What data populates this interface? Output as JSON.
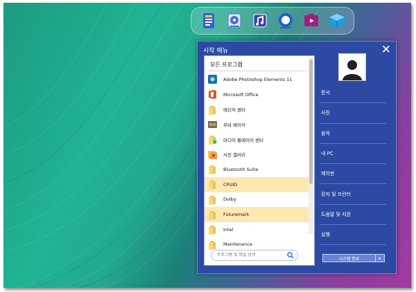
{
  "menu": {
    "title": "시작 메뉴",
    "close_glyph": "✕",
    "panel_header": "모든 프로그램",
    "programs": [
      {
        "label": "Adobe Photoshop Elements 11",
        "icon": "photoshop-elements-icon",
        "highlight": false
      },
      {
        "label": "Microsoft Office",
        "icon": "office-icon",
        "highlight": false
      },
      {
        "label": "메신저 센터",
        "icon": "folder-icon",
        "highlight": false
      },
      {
        "label": "무비 메이커",
        "icon": "movie-maker-icon",
        "highlight": false
      },
      {
        "label": "미디어 플레이어 센터",
        "icon": "folder-icon",
        "highlight": false
      },
      {
        "label": "사진 갤러리",
        "icon": "photo-gallery-icon",
        "highlight": false
      },
      {
        "label": "Bluetooth Suite",
        "icon": "folder-icon",
        "highlight": false
      },
      {
        "label": "CPUID",
        "icon": "folder-icon",
        "highlight": true
      },
      {
        "label": "Dolby",
        "icon": "folder-icon",
        "highlight": false
      },
      {
        "label": "Futuremark",
        "icon": "folder-icon",
        "highlight": true
      },
      {
        "label": "Intel",
        "icon": "folder-icon",
        "highlight": false
      },
      {
        "label": "Maintenance",
        "icon": "folder-icon",
        "highlight": false
      }
    ],
    "search_placeholder": "프로그램 및 파일 검색",
    "right_items": [
      "문서",
      "사진",
      "음악",
      "내 PC",
      "제어판",
      "장치 및 프린터",
      "도움말 및 지원",
      "실행"
    ],
    "shutdown_label": "시스템 종료",
    "shutdown_arrow": "▸"
  },
  "dock": {
    "icons": [
      "notebook-icon",
      "disc-drive-icon",
      "music-note-icon",
      "circle-app-icon",
      "media-player-icon",
      "cube-app-icon"
    ]
  },
  "colors": {
    "menu_bg": "#2c4aa3",
    "highlight": "#fce8b0"
  }
}
